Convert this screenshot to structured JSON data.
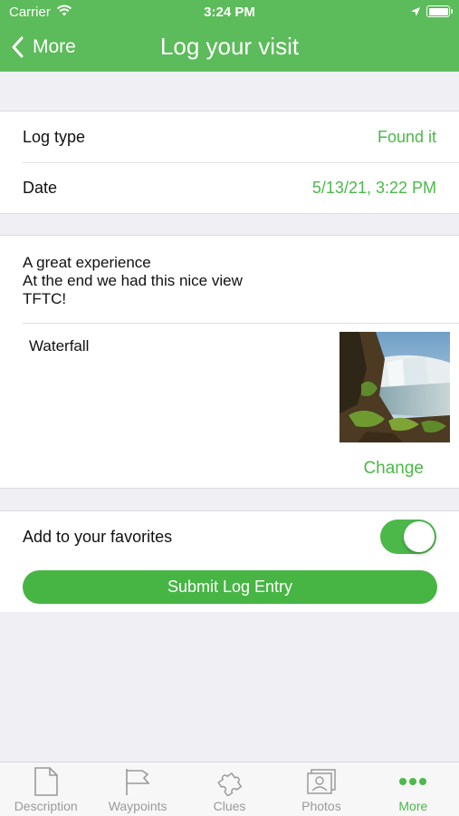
{
  "status_bar": {
    "carrier": "Carrier",
    "time": "3:24 PM"
  },
  "nav": {
    "back_label": "More",
    "title": "Log your visit"
  },
  "log_type": {
    "label": "Log type",
    "value": "Found it"
  },
  "date": {
    "label": "Date",
    "value": "5/13/21, 3:22 PM"
  },
  "notes": {
    "lines": [
      "A great experience",
      "At the end we had this nice view",
      "TFTC!"
    ]
  },
  "photo": {
    "caption": "Waterfall",
    "change_label": "Change"
  },
  "favorites": {
    "label": "Add to your favorites",
    "enabled": true
  },
  "submit_label": "Submit Log Entry",
  "tabs": [
    {
      "label": "Description",
      "icon": "document-icon"
    },
    {
      "label": "Waypoints",
      "icon": "flag-icon"
    },
    {
      "label": "Clues",
      "icon": "puzzle-icon"
    },
    {
      "label": "Photos",
      "icon": "photos-icon"
    },
    {
      "label": "More",
      "icon": "more-dots-icon"
    }
  ],
  "colors": {
    "brand_green": "#5cbb5a",
    "accent_green": "#4cb84a",
    "background": "#efeff4"
  }
}
